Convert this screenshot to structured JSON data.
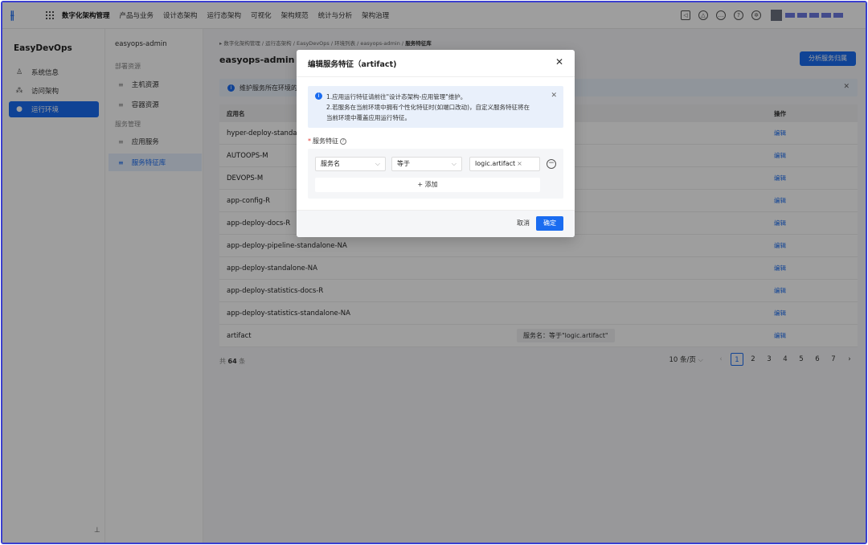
{
  "topnav": {
    "brand": "数字化架构管理",
    "items": [
      "产品与业务",
      "设计态架构",
      "运行态架构",
      "可视化",
      "架构规范",
      "统计与分析",
      "架构治理"
    ],
    "icons": [
      "speaker-icon",
      "bell-icon",
      "message-icon",
      "help-icon",
      "settings-icon"
    ]
  },
  "sidebar": {
    "app_title": "EasyDevOps",
    "items": [
      {
        "label": "系统信息",
        "icon": "user-icon"
      },
      {
        "label": "访问架构",
        "icon": "topology-icon"
      },
      {
        "label": "运行环境",
        "icon": "location-icon",
        "active": true
      }
    ]
  },
  "subsidebar": {
    "title": "easyops-admin",
    "group1": "部署资源",
    "host": "主机资源",
    "container": "容器资源",
    "group2": "服务管理",
    "app_service": "应用服务",
    "feature_lib": "服务特征库"
  },
  "main": {
    "breadcrumb": "数字化架构管理 / 运行态架构 / EasyDevOps / 环境列表 / easyops-admin /",
    "breadcrumb_current": "服务特征库",
    "title": "easyops-admin",
    "analyze_button": "分析服务归属",
    "banner": "维护服务所在环境的",
    "table": {
      "col_app": "应用名",
      "col_action": "操作",
      "rows": [
        {
          "name": "hyper-deploy-standalor",
          "feature": "",
          "action": "编辑"
        },
        {
          "name": "AUTOOPS-M",
          "feature": "",
          "action": "编辑"
        },
        {
          "name": "DEVOPS-M",
          "feature": "",
          "action": "编辑"
        },
        {
          "name": "app-config-R",
          "feature": "",
          "action": "编辑"
        },
        {
          "name": "app-deploy-docs-R",
          "feature": "",
          "action": "编辑"
        },
        {
          "name": "app-deploy-pipeline-standalone-NA",
          "feature": "",
          "action": "编辑"
        },
        {
          "name": "app-deploy-standalone-NA",
          "feature": "",
          "action": "编辑"
        },
        {
          "name": "app-deploy-statistics-docs-R",
          "feature": "",
          "action": "编辑"
        },
        {
          "name": "app-deploy-statistics-standalone-NA",
          "feature": "",
          "action": "编辑"
        },
        {
          "name": "artifact",
          "feature": "服务名：等于\"logic.artifact\"",
          "action": "编辑"
        }
      ]
    },
    "total_prefix": "共",
    "total_count": "64",
    "total_suffix": "条",
    "pager": {
      "size": "10 条/页",
      "pages": [
        "1",
        "2",
        "3",
        "4",
        "5",
        "6",
        "7"
      ],
      "current": "1"
    }
  },
  "modal": {
    "title": "编辑服务特征（artifact)",
    "alert_line1": "1.应用运行特征请前往\"设计态架构-应用管理\"维护。",
    "alert_line2": "2.若服务在当前环境中拥有个性化特征时(如端口改动)，自定义服务特征将在",
    "alert_line3": "当前环境中覆盖应用运行特征。",
    "field_label": "服务特征",
    "select_field": "服务名",
    "select_op": "等于",
    "value_chip": "logic.artifact",
    "add_label": "+ 添加",
    "cancel": "取消",
    "ok": "确定"
  },
  "colors": {
    "primary": "#1a6cf0",
    "frame": "#3a3fd0"
  }
}
